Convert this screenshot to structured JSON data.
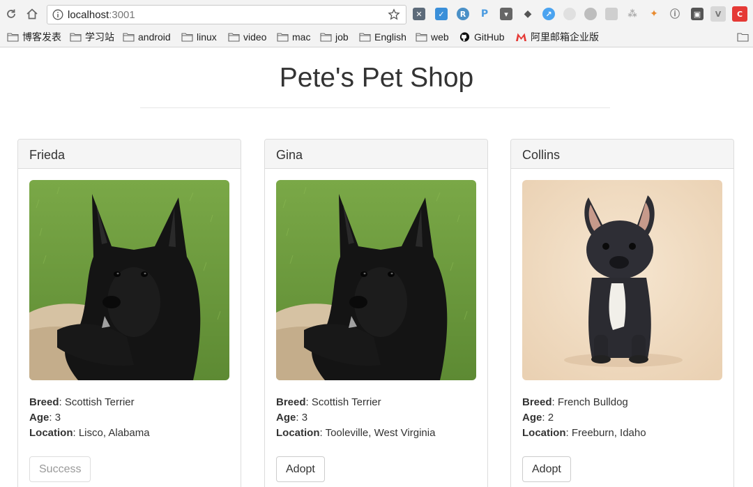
{
  "browser": {
    "url_host": "localhost",
    "url_port": ":3001",
    "bookmarks": [
      {
        "label": "博客发表",
        "icon": "folder-icon"
      },
      {
        "label": "学习站",
        "icon": "folder-icon"
      },
      {
        "label": "android",
        "icon": "folder-icon"
      },
      {
        "label": "linux",
        "icon": "folder-icon"
      },
      {
        "label": "video",
        "icon": "folder-icon"
      },
      {
        "label": "mac",
        "icon": "folder-icon"
      },
      {
        "label": "job",
        "icon": "folder-icon"
      },
      {
        "label": "English",
        "icon": "folder-icon"
      },
      {
        "label": "web",
        "icon": "folder-icon"
      },
      {
        "label": "GitHub",
        "icon": "github-icon"
      },
      {
        "label": "阿里邮箱企业版",
        "icon": "mail-m-icon"
      }
    ],
    "extensions": [
      "x-icon",
      "check-icon",
      "r-icon",
      "p-icon",
      "pocket-icon",
      "evernote-icon",
      "compass-icon",
      "ghost-icon",
      "cloud-icon",
      "stamp-icon",
      "tree-icon",
      "fox-icon",
      "info-icon",
      "briefcase-icon",
      "v-icon",
      "c-icon"
    ]
  },
  "page": {
    "title": "Pete's Pet Shop"
  },
  "labels": {
    "breed": "Breed",
    "age": "Age",
    "location": "Location"
  },
  "pets": [
    {
      "name": "Frieda",
      "breed": "Scottish Terrier",
      "age": "3",
      "location": "Lisco, Alabama",
      "button": "Success",
      "button_disabled": true,
      "photo": "scottish-terrier-photo"
    },
    {
      "name": "Gina",
      "breed": "Scottish Terrier",
      "age": "3",
      "location": "Tooleville, West Virginia",
      "button": "Adopt",
      "button_disabled": false,
      "photo": "scottish-terrier-photo"
    },
    {
      "name": "Collins",
      "breed": "French Bulldog",
      "age": "2",
      "location": "Freeburn, Idaho",
      "button": "Adopt",
      "button_disabled": false,
      "photo": "french-bulldog-photo"
    }
  ],
  "colors": {
    "accent_red": "#e53935",
    "card_header_bg": "#f5f5f5",
    "grass_green": "#6f9b3c",
    "studio_beige": "#f0dcc4"
  }
}
